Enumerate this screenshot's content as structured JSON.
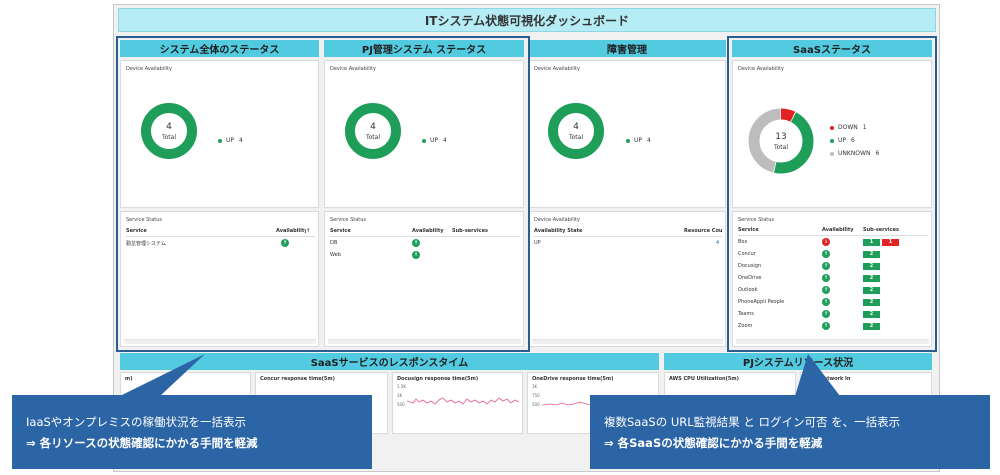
{
  "dashboard_title": "ITシステム状態可視化ダッシュボード",
  "sections": {
    "s1": "システム全体のステータス",
    "s2": "PJ管理システム ステータス",
    "s3": "障害管理",
    "s4": "SaaSステータス",
    "s5": "SaaSサービスのレスポンスタイム",
    "s6": "PJシステムリソース状況"
  },
  "labels": {
    "device_availability": "Device Availability",
    "service_status": "Service Status",
    "total": "Total",
    "col_service": "Service",
    "col_availability": "Availability",
    "col_sub": "Sub-services",
    "col_availability_state": "Availability State",
    "col_resource_count": "Resource Count"
  },
  "panel1": {
    "total": "4",
    "legend": [
      {
        "label": "UP",
        "count": "4"
      }
    ],
    "rows": [
      {
        "service": "勤怠管理システム",
        "state": "ok"
      }
    ],
    "sort_mark": "↑"
  },
  "panel2": {
    "total": "4",
    "legend": [
      {
        "label": "UP",
        "count": "4"
      }
    ],
    "rows": [
      {
        "service": "DB"
      },
      {
        "service": "Web"
      }
    ]
  },
  "panel3": {
    "total": "4",
    "legend": [
      {
        "label": "UP",
        "count": "4"
      }
    ],
    "state": "UP",
    "count": "4"
  },
  "panel4": {
    "total": "13",
    "legend": [
      {
        "label": "DOWN",
        "count": "1",
        "color": "#e02424"
      },
      {
        "label": "UP",
        "count": "6",
        "color": "#1f9e5a"
      },
      {
        "label": "UNKNOWN",
        "count": "6",
        "color": "#bdbdbd"
      }
    ],
    "rows": [
      {
        "service": "Box",
        "state": "ng",
        "subs": [
          "1",
          "1"
        ]
      },
      {
        "service": "Concur",
        "state": "ok",
        "subs": [
          "2"
        ]
      },
      {
        "service": "Docusign",
        "state": "ok",
        "subs": [
          "2"
        ]
      },
      {
        "service": "OneDrive",
        "state": "ok",
        "subs": [
          "2"
        ]
      },
      {
        "service": "Outlook",
        "state": "ok",
        "subs": [
          "2"
        ]
      },
      {
        "service": "PhoneAppli People",
        "state": "ok",
        "subs": [
          "2"
        ]
      },
      {
        "service": "Teams",
        "state": "ok",
        "subs": [
          "2"
        ]
      },
      {
        "service": "Zoom",
        "state": "ok",
        "subs": [
          "2"
        ]
      }
    ]
  },
  "response_cards": [
    {
      "title": "m)"
    },
    {
      "title": "Concur response time(5m)"
    },
    {
      "title": "Docusign response time(5m)",
      "ticks": [
        "1.5K",
        "1K",
        "500"
      ]
    },
    {
      "title": "OneDrive response time(5m)",
      "ticks": [
        "1K",
        "750",
        "500"
      ]
    },
    {
      "title": "AWS CPU Utilization(5m)"
    },
    {
      "title": "AWS Network In"
    }
  ],
  "callouts": {
    "left_line1": "IaaSやオンプレミスの稼働状況を一括表示",
    "left_line2": "⇒  各リソースの状態確認にかかる手間を軽減",
    "right_line1": "複数SaaSの URL監視結果 と ログイン可否 を、一括表示",
    "right_line2": "⇒  各SaaSの状態確認にかかる手間を軽減"
  },
  "colors": {
    "up": "#1f9e5a",
    "down": "#e02424",
    "unknown": "#bdbdbd",
    "section": "#52cbe1",
    "banner": "#b6ecf5",
    "callout": "#2c65a5",
    "highlight": "#2a5d93"
  }
}
